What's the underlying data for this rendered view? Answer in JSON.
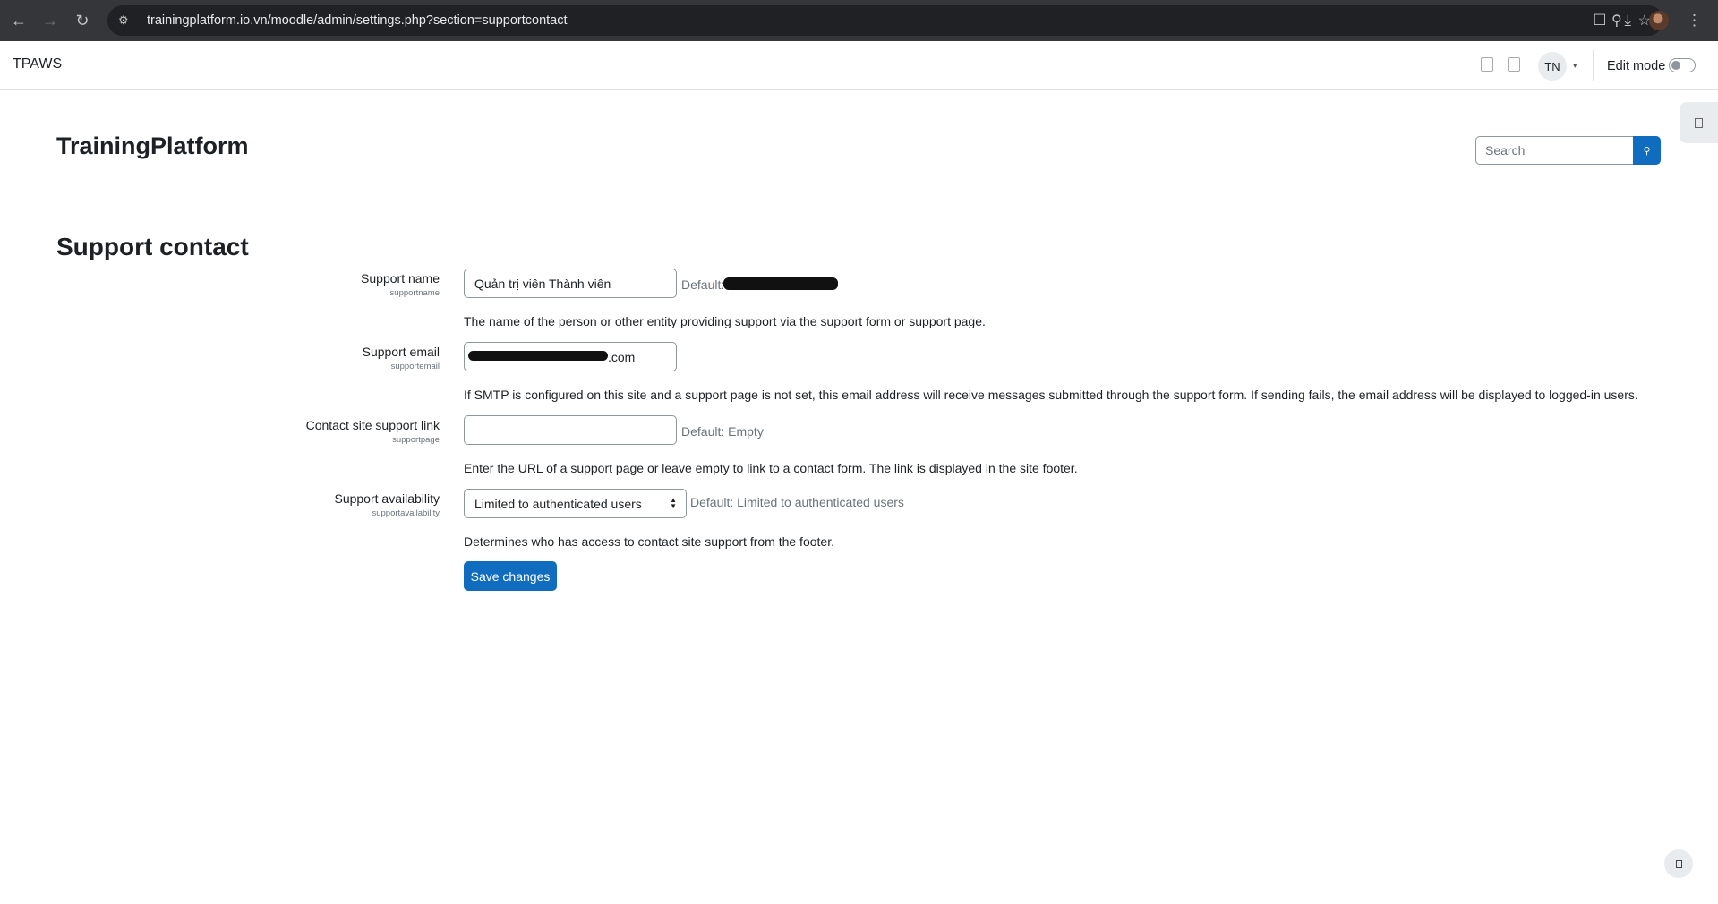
{
  "browser": {
    "url": "trainingplatform.io.vn/moodle/admin/settings.php?section=supportcontact",
    "back_icon": "arrow-left",
    "forward_icon": "arrow-right",
    "reload_icon": "reload"
  },
  "navbar": {
    "brand": "TPAWS",
    "avatar_initials": "TN",
    "edit_mode_label": "Edit mode",
    "edit_mode_on": false
  },
  "header": {
    "site_title": "TrainingPlatform",
    "search_placeholder": "Search"
  },
  "page": {
    "heading": "Support contact"
  },
  "form": {
    "support_name": {
      "label": "Support name",
      "key": "supportname",
      "value": "Quản trị viên Thành viên",
      "default_prefix": "Default:",
      "description": "The name of the person or other entity providing support via the support form or support page."
    },
    "support_email": {
      "label": "Support email",
      "key": "supportemail",
      "value_suffix": ".com",
      "description": "If SMTP is configured on this site and a support page is not set, this email address will receive messages submitted through the support form. If sending fails, the email address will be displayed to logged-in users."
    },
    "support_page": {
      "label": "Contact site support link",
      "key": "supportpage",
      "value": "",
      "default_text": "Default: Empty",
      "description": "Enter the URL of a support page or leave empty to link to a contact form. The link is displayed in the site footer."
    },
    "support_availability": {
      "label": "Support availability",
      "key": "supportavailability",
      "selected": "Limited to authenticated users",
      "default_text": "Default: Limited to authenticated users",
      "description": "Determines who has access to contact site support from the footer."
    },
    "save_label": "Save changes"
  },
  "colors": {
    "primary": "#0f6cbf",
    "chrome_bg": "#35363a"
  }
}
